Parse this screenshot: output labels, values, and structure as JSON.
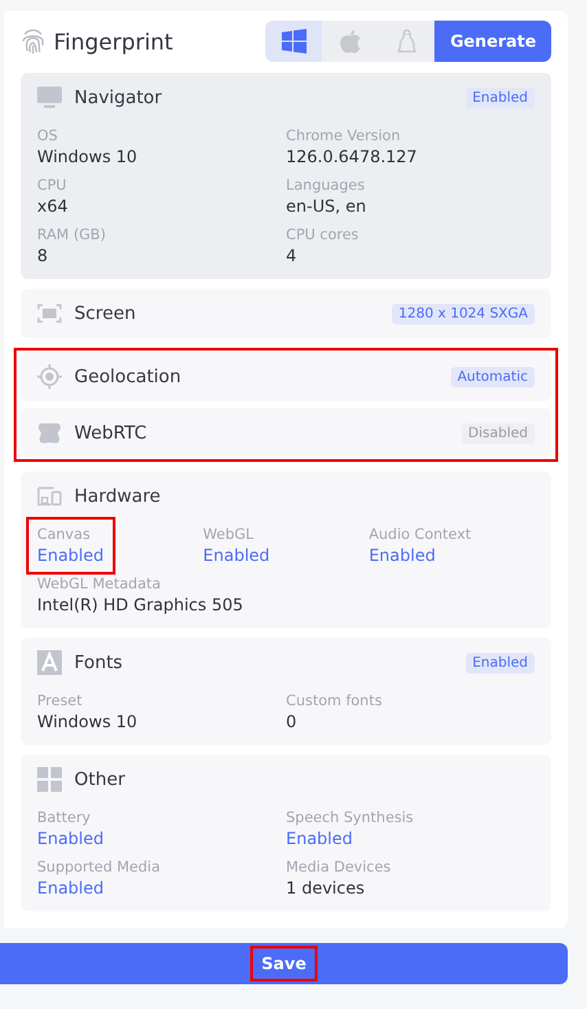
{
  "header": {
    "title": "Fingerprint",
    "os_tabs": [
      {
        "kind": "windows",
        "selected": true
      },
      {
        "kind": "apple",
        "selected": false
      },
      {
        "kind": "linux",
        "selected": false
      }
    ],
    "generate_button": "Generate"
  },
  "sections": [
    {
      "kind": "monitor",
      "title": "Navigator",
      "highlighted": false,
      "badge": {
        "text": "Enabled",
        "kind": "active"
      },
      "rows": [
        [
          {
            "label": "OS",
            "value": "Windows 10",
            "kind": "text",
            "highlighted": false
          },
          {
            "label": "Chrome Version",
            "value": "126.0.6478.127",
            "kind": "text",
            "highlighted": false
          }
        ],
        [
          {
            "label": "CPU",
            "value": "x64",
            "kind": "text",
            "highlighted": false
          },
          {
            "label": "Languages",
            "value": "en-US, en",
            "kind": "text",
            "highlighted": false
          }
        ],
        [
          {
            "label": "RAM (GB)",
            "value": "8",
            "kind": "text",
            "highlighted": false
          },
          {
            "label": "CPU cores",
            "value": "4",
            "kind": "text",
            "highlighted": false
          }
        ]
      ]
    },
    {
      "kind": "screen",
      "title": "Screen",
      "highlighted": false,
      "badge": {
        "text": "1280 x 1024 SXGA",
        "kind": "active"
      }
    },
    {
      "kind": "target",
      "title": "Geolocation",
      "highlighted": true,
      "badge": {
        "text": "Automatic",
        "kind": "active"
      }
    },
    {
      "kind": "webrtc",
      "title": "WebRTC",
      "highlighted": true,
      "badge": {
        "text": "Disabled",
        "kind": "inactive"
      }
    },
    {
      "kind": "hardware",
      "title": "Hardware",
      "highlighted": false,
      "rows": [
        [
          {
            "label": "Canvas",
            "value": "Enabled",
            "kind": "status",
            "highlighted": true
          },
          {
            "label": "WebGL",
            "value": "Enabled",
            "kind": "status",
            "highlighted": false
          },
          {
            "label": "Audio Context",
            "value": "Enabled",
            "kind": "status",
            "highlighted": false
          }
        ],
        [
          {
            "label": "WebGL Metadata",
            "value": "Intel(R) HD Graphics 505",
            "kind": "text",
            "highlighted": false
          }
        ]
      ]
    },
    {
      "kind": "fonts",
      "title": "Fonts",
      "highlighted": false,
      "badge": {
        "text": "Enabled",
        "kind": "active"
      },
      "rows": [
        [
          {
            "label": "Preset",
            "value": "Windows 10",
            "kind": "text",
            "highlighted": false
          },
          {
            "label": "Custom fonts",
            "value": "0",
            "kind": "text",
            "highlighted": false
          }
        ]
      ]
    },
    {
      "kind": "grid",
      "title": "Other",
      "highlighted": false,
      "rows": [
        [
          {
            "label": "Battery",
            "value": "Enabled",
            "kind": "status",
            "highlighted": false
          },
          {
            "label": "Speech Synthesis",
            "value": "Enabled",
            "kind": "status",
            "highlighted": false
          }
        ],
        [
          {
            "label": "Supported Media",
            "value": "Enabled",
            "kind": "status",
            "highlighted": false
          },
          {
            "label": "Media Devices",
            "value": "1 devices",
            "kind": "text",
            "highlighted": false
          }
        ]
      ]
    }
  ],
  "save_button": {
    "text": "Save",
    "highlighted": true
  }
}
